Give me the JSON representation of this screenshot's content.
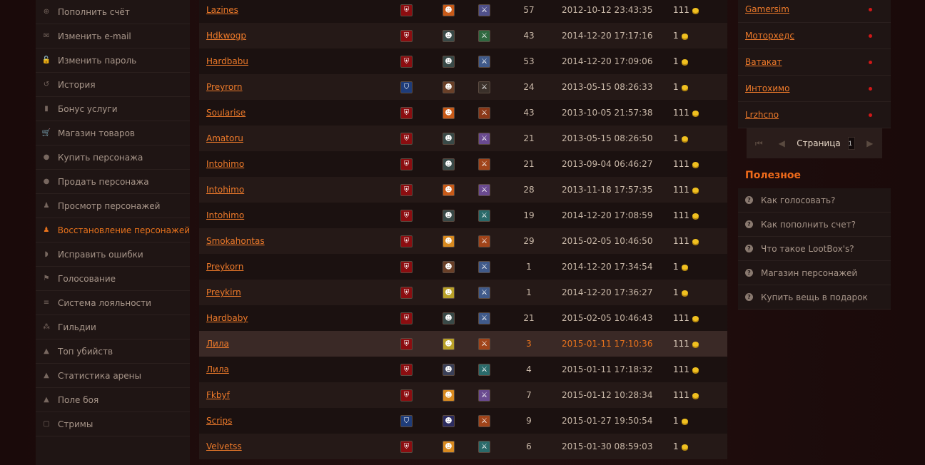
{
  "left_menu": [
    {
      "label": "Пополнить счёт",
      "icon": "plus-circle-icon",
      "glyph": "⊕",
      "active": false
    },
    {
      "label": "Изменить e-mail",
      "icon": "envelope-icon",
      "glyph": "✉",
      "active": false
    },
    {
      "label": "Изменить пароль",
      "icon": "lock-icon",
      "glyph": "🔓",
      "active": false
    },
    {
      "label": "История",
      "icon": "history-icon",
      "glyph": "↺",
      "active": false
    },
    {
      "label": "Бонус услуги",
      "icon": "bonus-icon",
      "glyph": "▮",
      "active": false
    },
    {
      "label": "Магазин товаров",
      "icon": "cart-icon",
      "glyph": "🛒",
      "active": false
    },
    {
      "label": "Купить персонажа",
      "icon": "user-icon",
      "glyph": "●",
      "active": false
    },
    {
      "label": "Продать персонажа",
      "icon": "user-icon",
      "glyph": "●",
      "active": false
    },
    {
      "label": "Просмотр персонажей",
      "icon": "person-icon",
      "glyph": "♟",
      "active": false
    },
    {
      "label": "Восстановление персонажей",
      "icon": "person-icon",
      "glyph": "♟",
      "active": true
    },
    {
      "label": "Исправить ошибки",
      "icon": "shield-icon",
      "glyph": "◗",
      "active": false
    },
    {
      "label": "Голосование",
      "icon": "flag-icon",
      "glyph": "⚑",
      "active": false
    },
    {
      "label": "Система лояльности",
      "icon": "list-icon",
      "glyph": "≡",
      "active": false
    },
    {
      "label": "Гильдии",
      "icon": "group-icon",
      "glyph": "⁂",
      "active": false
    },
    {
      "label": "Топ убийств",
      "icon": "chart-icon",
      "glyph": "▲",
      "active": false
    },
    {
      "label": "Статистика арены",
      "icon": "chart-icon",
      "glyph": "▲",
      "active": false
    },
    {
      "label": "Поле боя",
      "icon": "chart-icon",
      "glyph": "▲",
      "active": false
    },
    {
      "label": "Стримы",
      "icon": "chat-icon",
      "glyph": "▢",
      "active": false
    }
  ],
  "characters": [
    {
      "name": "Lazines",
      "faction": "horde",
      "race": "a",
      "cls": "a",
      "level": "57",
      "date": "2012-10-12 23:43:35",
      "price": "111"
    },
    {
      "name": "Hdkwogp",
      "faction": "horde",
      "race": "b",
      "cls": "b",
      "level": "43",
      "date": "2014-12-20 17:17:16",
      "price": "1"
    },
    {
      "name": "Hardbabu",
      "faction": "horde",
      "race": "b",
      "cls": "c",
      "level": "53",
      "date": "2014-12-20 17:09:06",
      "price": "1"
    },
    {
      "name": "Preyrorn",
      "faction": "alliance",
      "race": "e",
      "cls": "d",
      "level": "24",
      "date": "2013-05-15 08:26:33",
      "price": "1"
    },
    {
      "name": "Soularise",
      "faction": "horde",
      "race": "a",
      "cls": "e",
      "level": "43",
      "date": "2013-10-05 21:57:38",
      "price": "111"
    },
    {
      "name": "Amatoru",
      "faction": "horde",
      "race": "b",
      "cls": "f",
      "level": "21",
      "date": "2013-05-15 08:26:50",
      "price": "1"
    },
    {
      "name": "Intohimo",
      "faction": "horde",
      "race": "b",
      "cls": "h",
      "level": "21",
      "date": "2013-09-04 06:46:27",
      "price": "111"
    },
    {
      "name": "Intohimo",
      "faction": "horde",
      "race": "a",
      "cls": "f",
      "level": "28",
      "date": "2013-11-18 17:57:35",
      "price": "111"
    },
    {
      "name": "Intohimo",
      "faction": "horde",
      "race": "b",
      "cls": "g",
      "level": "19",
      "date": "2014-12-20 17:08:59",
      "price": "111"
    },
    {
      "name": "Smokahontas",
      "faction": "horde",
      "race": "d",
      "cls": "h",
      "level": "29",
      "date": "2015-02-05 10:46:50",
      "price": "111"
    },
    {
      "name": "Preykorn",
      "faction": "horde",
      "race": "e",
      "cls": "c",
      "level": "1",
      "date": "2014-12-20 17:34:54",
      "price": "1"
    },
    {
      "name": "Preykirn",
      "faction": "horde",
      "race": "f",
      "cls": "c",
      "level": "1",
      "date": "2014-12-20 17:36:27",
      "price": "1"
    },
    {
      "name": "Hardbaby",
      "faction": "horde",
      "race": "b",
      "cls": "c",
      "level": "21",
      "date": "2015-02-05 10:46:43",
      "price": "111"
    },
    {
      "name": "Лила",
      "faction": "horde",
      "race": "f",
      "cls": "h",
      "level": "3",
      "date": "2015-01-11 17:10:36",
      "price": "111",
      "highlight": true
    },
    {
      "name": "Лила",
      "faction": "horde",
      "race": "c",
      "cls": "g",
      "level": "4",
      "date": "2015-01-11 17:18:32",
      "price": "111"
    },
    {
      "name": "Fkbyf",
      "faction": "horde",
      "race": "d",
      "cls": "f",
      "level": "7",
      "date": "2015-01-12 10:28:34",
      "price": "111"
    },
    {
      "name": "Scrips",
      "faction": "alliance",
      "race": "g",
      "cls": "h",
      "level": "9",
      "date": "2015-01-27 19:50:54",
      "price": "1"
    },
    {
      "name": "Velvetss",
      "faction": "horde",
      "race": "d",
      "cls": "g",
      "level": "6",
      "date": "2015-01-30 08:59:03",
      "price": "1"
    }
  ],
  "online_players": [
    "Gamersim",
    "Моторхедс",
    "Ватакат",
    "Интохимо",
    "Lrzhcno"
  ],
  "pager": {
    "label": "Страница",
    "value": "1",
    "first": "⏮",
    "prev": "◀",
    "next": "▶"
  },
  "help": {
    "title": "Полезное",
    "items": [
      "Как голосовать?",
      "Как пополнить счет?",
      "Что такое LootBox's?",
      "Магазин персонажей",
      "Купить вещь в подарок"
    ]
  },
  "colors": {
    "accent": "#ee7a2a",
    "horde": "#8b0d10",
    "alliance": "#1e3c7a",
    "online_dot": "#d01818",
    "coin": "#f0c020"
  }
}
